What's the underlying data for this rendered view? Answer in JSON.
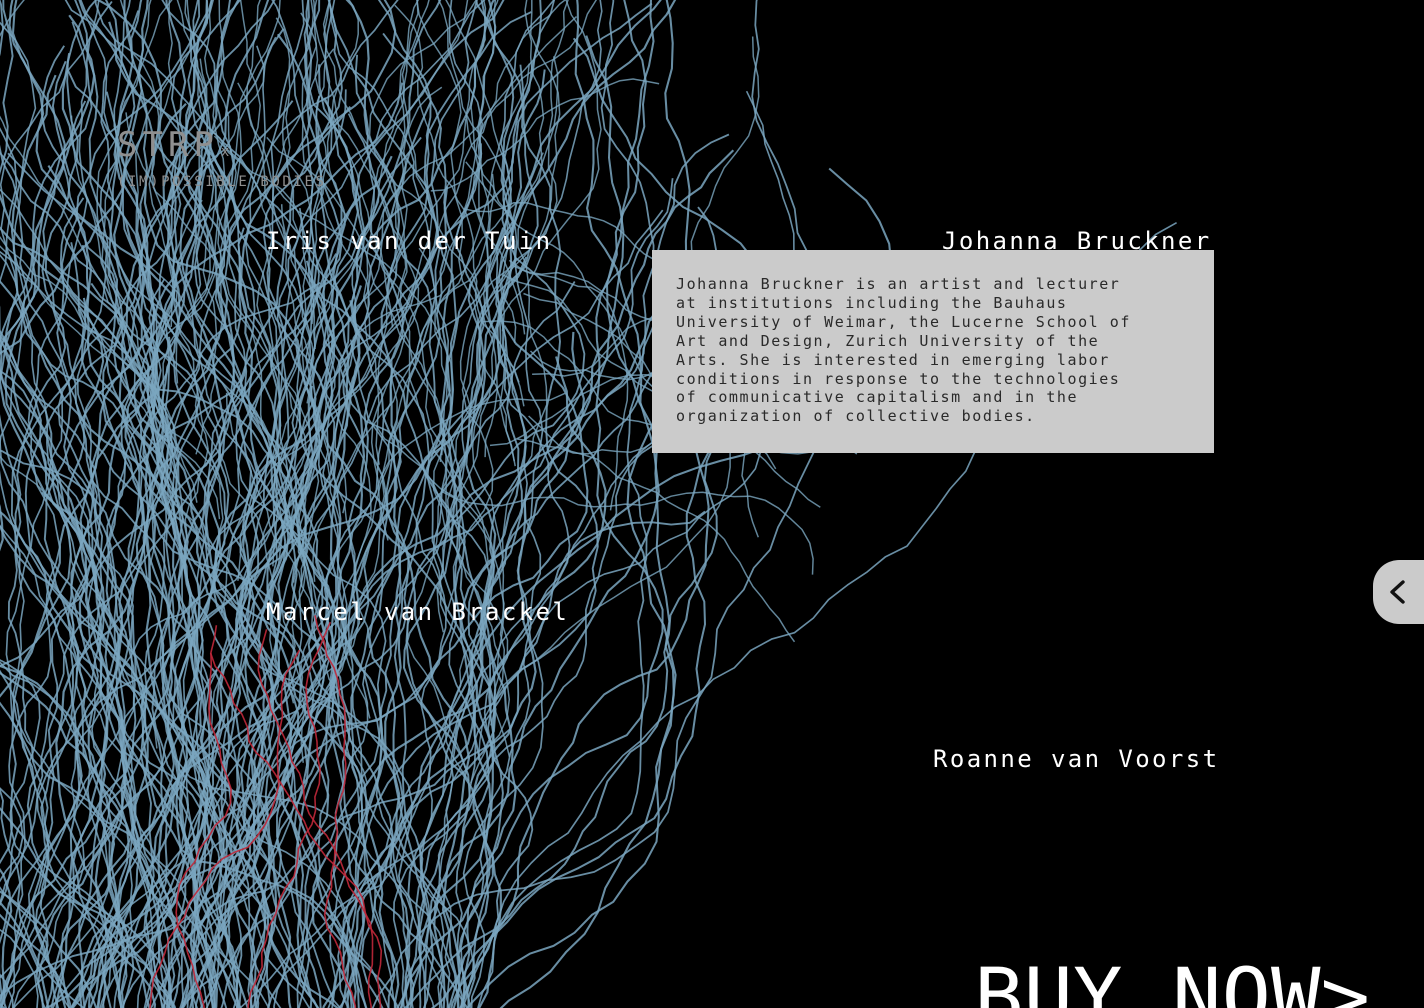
{
  "logo": {
    "main": "STRP",
    "x": "x",
    "subtitle": "(IM)POSSIBLE BODIES"
  },
  "speakers": [
    {
      "name": "Iris van der Tuin"
    },
    {
      "name": "Johanna Bruckner"
    },
    {
      "name": "Marcel van Brackel"
    },
    {
      "name": "Roanne van Voorst"
    }
  ],
  "bio": {
    "text": "Johanna Bruckner is an artist and lecturer\nat institutions including the Bauhaus\nUniversity of Weimar, the Lucerne School of\nArt and Design, Zurich University of the\nArts. She is interested in emerging labor\nconditions in response to the technologies\nof communicative capitalism and in the\norganization of collective bodies."
  },
  "side_tab": {
    "icon": "chevron-left-icon"
  },
  "cta": {
    "label": "BUY NOW>"
  },
  "colors": {
    "background": "#000000",
    "thread": "#7aa6bf",
    "thread_accent": "#c0283a",
    "card": "#cbcbcb"
  }
}
